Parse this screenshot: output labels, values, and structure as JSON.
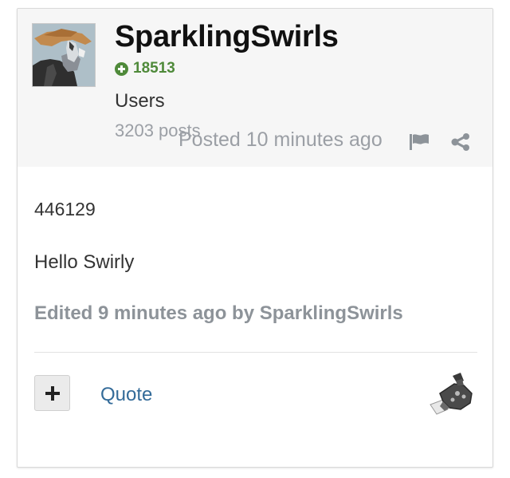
{
  "author": {
    "username": "SparklingSwirls",
    "reputation": "18513",
    "group": "Users",
    "post_count": "3203 posts"
  },
  "post": {
    "posted_time": "Posted 10 minutes ago",
    "id_line": "446129",
    "body": "Hello Swirly",
    "edited_note": "Edited 9 minutes ago by SparklingSwirls"
  },
  "actions": {
    "quote_label": "Quote",
    "report_icon": "flag-icon",
    "share_icon": "share-icon",
    "multiquote_icon": "plus-icon"
  },
  "colors": {
    "reputation": "#4f8a3a",
    "link": "#336b99",
    "muted": "#9b9fa5",
    "header_bg": "#f6f6f6"
  }
}
